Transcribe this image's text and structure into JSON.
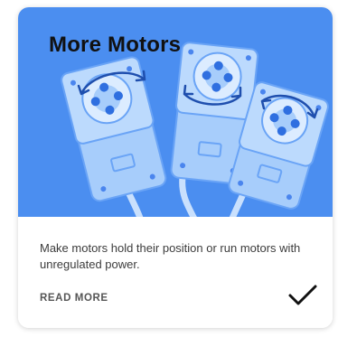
{
  "card": {
    "title": "More Motors",
    "description": "Make motors hold their position or run motors with unregulated power.",
    "read_more_label": "READ MORE",
    "completed": true
  },
  "icons": {
    "check": "check-icon",
    "illustration": "servo-motors-illustration"
  },
  "colors": {
    "hero_background": "#4b8ef0",
    "motor_body": "#a7cdfb",
    "motor_line": "#5b9af5",
    "hub": "#2f6fe0",
    "title": "#111111",
    "text": "#3c3c3c"
  }
}
